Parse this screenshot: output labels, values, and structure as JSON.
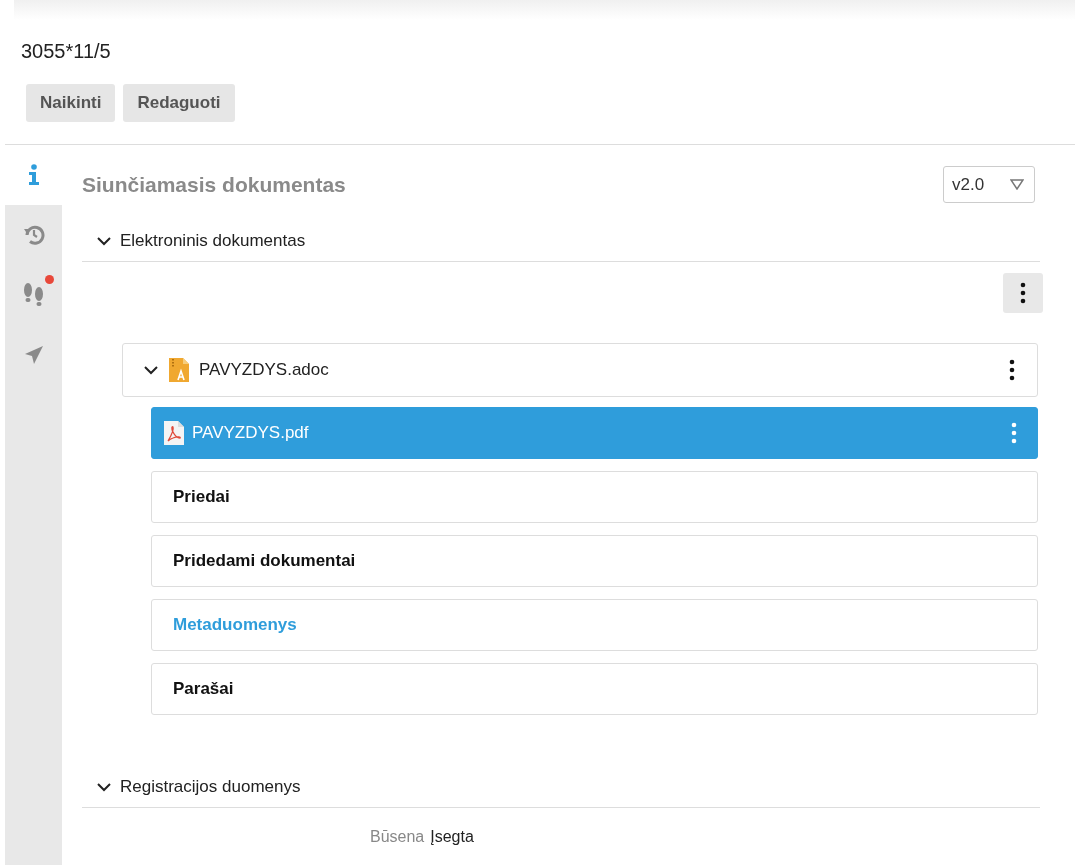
{
  "document_number": "3055*11/5",
  "actions": [
    "Naikinti",
    "Redaguoti"
  ],
  "side_tabs": [
    {
      "kind": "info",
      "selected": true,
      "alert": false
    },
    {
      "kind": "history",
      "selected": false,
      "alert": false
    },
    {
      "kind": "steps",
      "selected": false,
      "alert": true
    },
    {
      "kind": "send",
      "selected": false,
      "alert": false
    }
  ],
  "heading": "Siunčiamasis dokumentas",
  "version": "v2.0",
  "sections": [
    {
      "title": "Elektroninis dokumentas",
      "expanded": true
    },
    {
      "title": "Registracijos duomenys",
      "expanded": true
    }
  ],
  "tree": {
    "name": "PAVYZDYS.adoc",
    "kind": "adoc",
    "expanded": true,
    "selected": false,
    "children": [
      {
        "name": "PAVYZDYS.pdf",
        "kind": "pdf",
        "selected": true
      }
    ]
  },
  "groups": [
    {
      "label": "Priedai",
      "active": false
    },
    {
      "label": "Pridedami dokumentai",
      "active": false
    },
    {
      "label": "Metaduomenys",
      "active": true
    },
    {
      "label": "Parašai",
      "active": false
    }
  ],
  "fields": [
    {
      "label": "Būsena",
      "value": "Įsegta"
    }
  ]
}
